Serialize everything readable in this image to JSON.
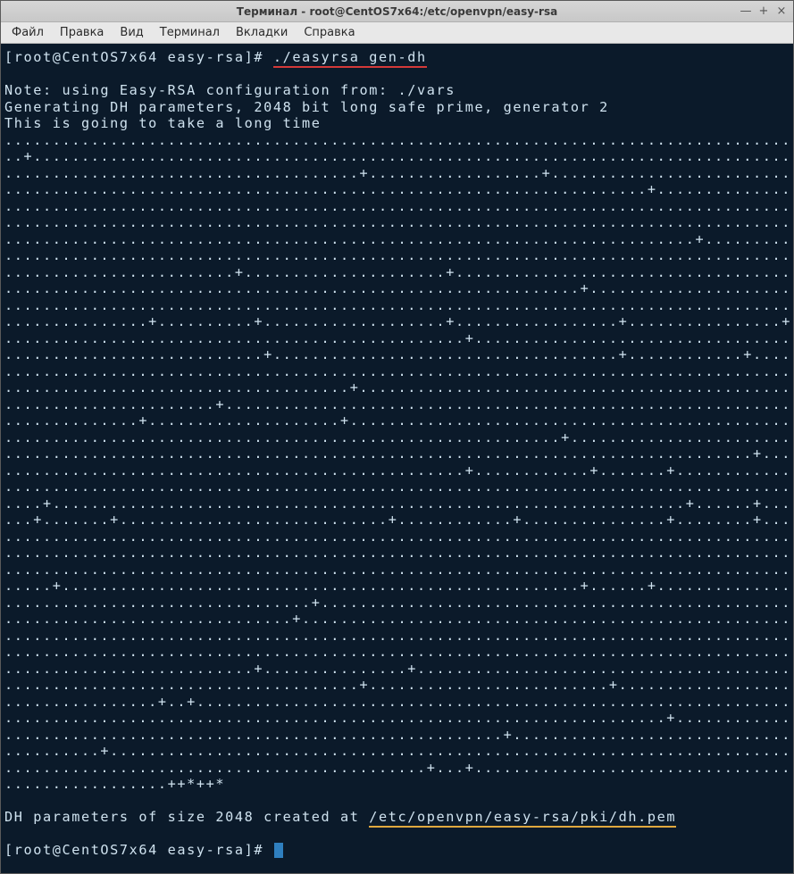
{
  "window": {
    "title": "Терминал - root@CentOS7x64:/etc/openvpn/easy-rsa"
  },
  "menubar": {
    "file": "Файл",
    "edit": "Правка",
    "view": "Вид",
    "terminal": "Терминал",
    "tabs": "Вкладки",
    "help": "Справка"
  },
  "prompt1_pre": "[root@CentOS7x64 easy-rsa]# ",
  "command1": "./easyrsa gen-dh",
  "blank": "",
  "note1": "Note: using Easy-RSA configuration from: ./vars",
  "note2": "Generating DH parameters, 2048 bit long safe prime, generator 2",
  "note3": "This is going to take a long time",
  "progress": [
    "............................................................................................",
    "..+.........................................................................................",
    ".....................................+..................+...................................",
    "...................................................................+........................",
    "............................................................................................",
    "............................................................................................",
    "........................................................................+...................",
    ".........................................................................................+..",
    "........................+.....................+.............................................",
    "............................................................+...............................",
    "............................................................................................",
    "...............+..........+...................+.................+................+.....+....",
    "................................................+...........................................",
    "...........................+....................................+............+..............",
    "............................................................................................",
    "....................................+.......................................................",
    "......................+.....................................................................",
    "..............+....................+........................................................",
    "..........................................................+.................................",
    "..............................................................................+.............",
    "................................................+............+.......+......................",
    "............................................................................................",
    "....+..................................................................+......+.............",
    "...+.......+............................+............+...............+........+.............",
    "........................................................................................+...",
    "............................................................................................",
    "............................................................................................",
    ".....+......................................................+......+........................",
    "................................+...........................................................",
    "..............................+.............................................................",
    "............................................................................................",
    "............................................................................................",
    "..........................+...............+.................................................",
    ".....................................+.........................+............................",
    "................+..+........................................................................",
    ".....................................................................+......................",
    "....................................................+.......................................",
    "..........+.........................................................................+.......",
    "............................................+...+...........................................",
    ".................++*++*"
  ],
  "result_pre": "DH parameters of size 2048 created at ",
  "result_path": "/etc/openvpn/easy-rsa/pki/dh.pem",
  "prompt2": "[root@CentOS7x64 easy-rsa]# "
}
